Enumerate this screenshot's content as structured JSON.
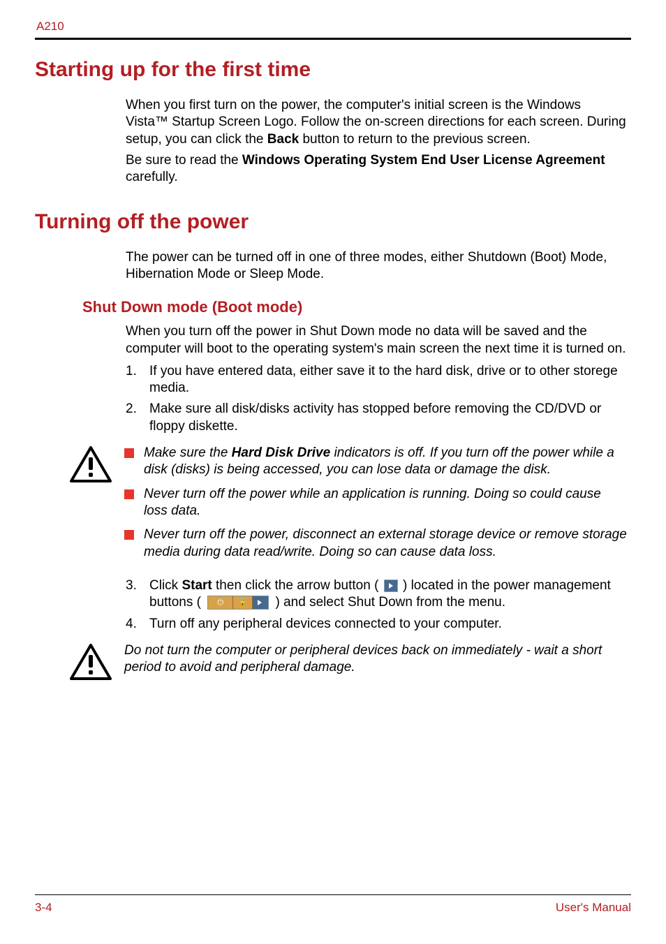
{
  "header": {
    "model": "A210"
  },
  "s1": {
    "title": "Starting up for the first time",
    "p1_a": "When you first turn on the power, the computer's initial screen is the Windows Vista™ Startup Screen Logo. Follow the on-screen directions for each screen. During setup, you can click the ",
    "p1_bold": "Back",
    "p1_b": " button to return to the previous screen.",
    "p2_a": "Be sure to read the ",
    "p2_bold": "Windows Operating System End User License Agreement",
    "p2_b": " carefully."
  },
  "s2": {
    "title": "Turning off the power",
    "intro": "The power can be turned off in one of three modes, either Shutdown (Boot) Mode, Hibernation Mode or Sleep Mode.",
    "sub1": {
      "title": "Shut Down mode (Boot mode)",
      "intro": "When you turn off the power in Shut Down mode no data will be saved and the computer will boot to the operating system's main screen the next time it is turned on.",
      "li1_num": "1.",
      "li1": "If you have entered data, either save it to the hard disk, drive or to other storege media.",
      "li2_num": "2.",
      "li2": "Make sure all disk/disks activity has stopped before removing the CD/DVD or floppy diskette.",
      "caution1": {
        "b1_a": "Make sure the ",
        "b1_bold": "Hard Disk Drive",
        "b1_b": " indicators is off. If you turn off the power while a disk (disks) is being accessed, you can lose data or damage the disk.",
        "b2": "Never turn off the power while an application is running. Doing so could cause loss data.",
        "b3": "Never turn off the power, disconnect an external storage device or remove storage media during data read/write. Doing so can cause data loss."
      },
      "li3_num": "3.",
      "li3_a": "Click ",
      "li3_bold": "Start",
      "li3_b": " then click the arrow button ( ",
      "li3_c": " ) located in the power management buttons ( ",
      "li3_d": " ) and select Shut Down from the menu.",
      "li4_num": "4.",
      "li4": "Turn off any peripheral devices connected to your computer.",
      "caution2": "Do not turn the computer or peripheral devices back on immediately - wait a short period to avoid and peripheral damage."
    }
  },
  "footer": {
    "page": "3-4",
    "label": "User's Manual"
  }
}
